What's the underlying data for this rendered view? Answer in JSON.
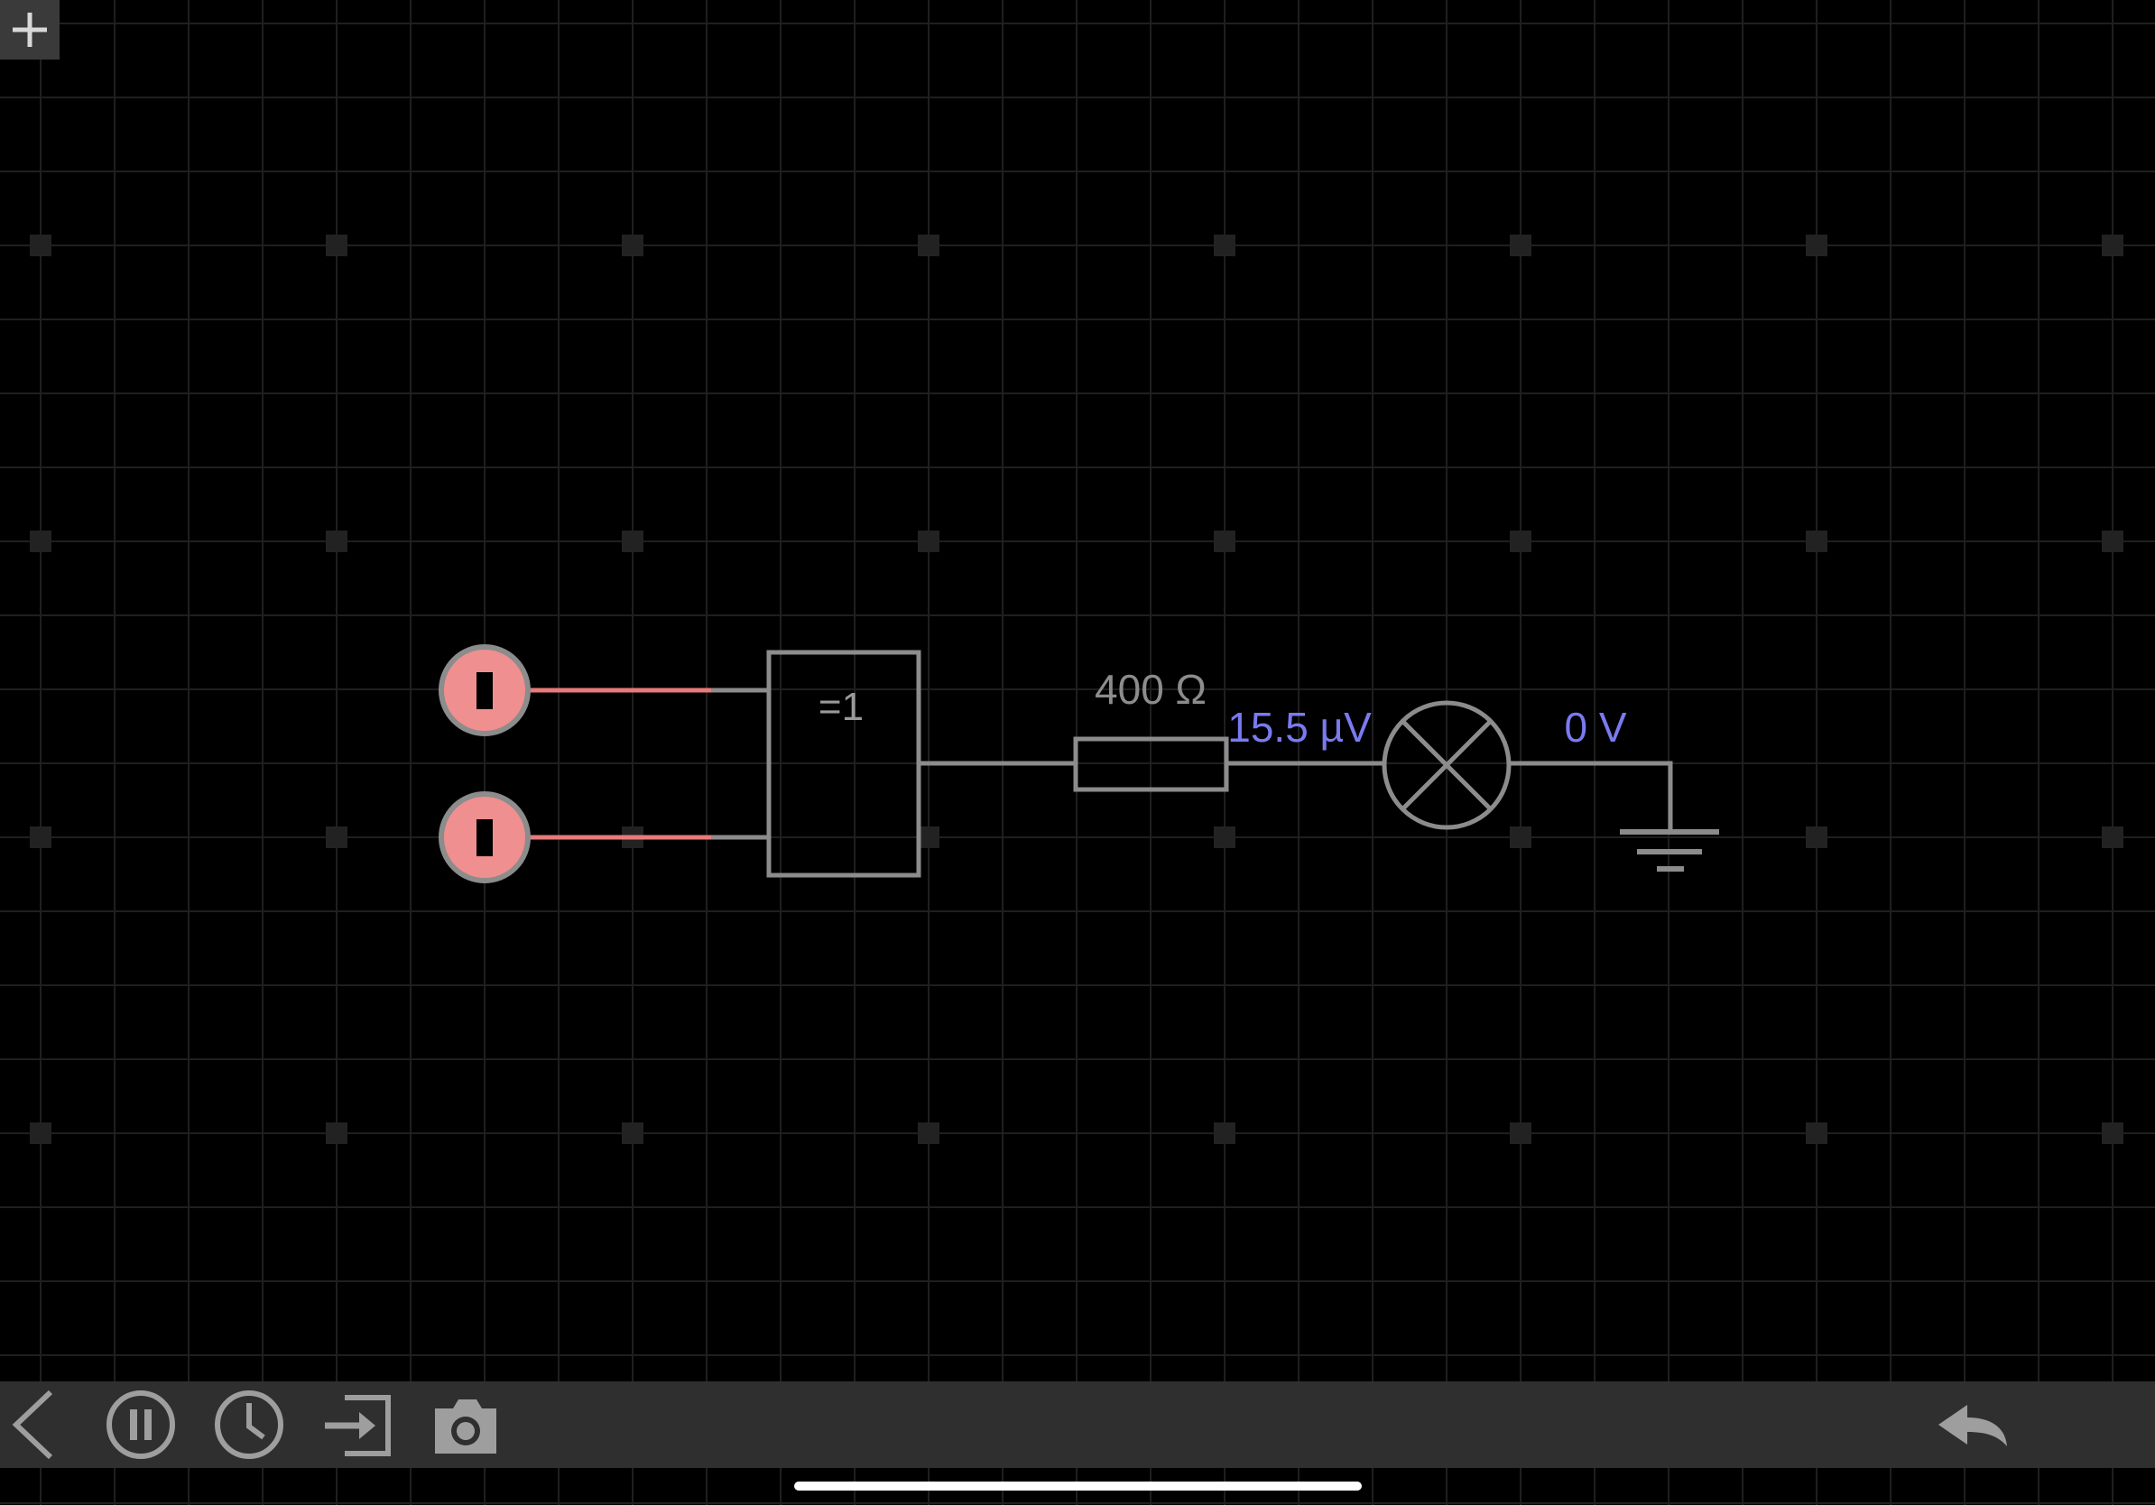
{
  "app": {
    "add_button_icon": "plus-icon"
  },
  "circuit": {
    "gate": {
      "type": "XOR",
      "label": "=1"
    },
    "resistor": {
      "label": "400 Ω"
    },
    "probes": {
      "lamp_input_voltage": "15.5 µV",
      "lamp_output_voltage": "0 V"
    },
    "switches": [
      {
        "name": "input-switch-1",
        "state": "I"
      },
      {
        "name": "input-switch-2",
        "state": "I"
      }
    ],
    "colors": {
      "wire": "#8c8c8c",
      "wire_active": "#e87a7a",
      "switch_fill": "#f08f8f",
      "voltage_label": "#7a7af0",
      "grid_minor": "#1f1f1f",
      "grid_major": "#2a2a2a"
    }
  },
  "toolbar": {
    "left_icons": [
      "back-icon",
      "pause-icon",
      "clock-icon",
      "import-icon",
      "camera-icon"
    ],
    "right_icons": [
      "undo-icon"
    ]
  }
}
